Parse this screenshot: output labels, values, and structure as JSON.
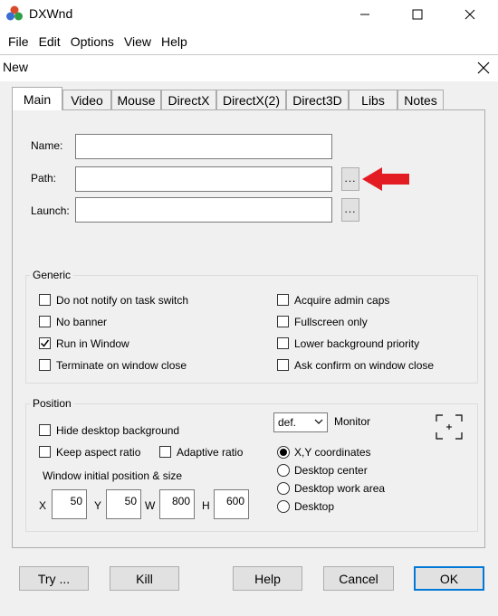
{
  "app": {
    "title": "DXWnd"
  },
  "menu": [
    "File",
    "Edit",
    "Options",
    "View",
    "Help"
  ],
  "dialog": {
    "title": "New"
  },
  "tabs": [
    "Main",
    "Video",
    "Mouse",
    "DirectX",
    "DirectX(2)",
    "Direct3D",
    "Libs",
    "Notes"
  ],
  "active_tab": "Main",
  "main": {
    "name_label": "Name:",
    "name_value": "",
    "path_label": "Path:",
    "path_value": "",
    "launch_label": "Launch:",
    "launch_value": "",
    "browse_label": "..."
  },
  "generic": {
    "title": "Generic",
    "options": [
      {
        "label": "Do not notify on task switch",
        "checked": false
      },
      {
        "label": "No banner",
        "checked": false
      },
      {
        "label": "Run in Window",
        "checked": true
      },
      {
        "label": "Terminate on window close",
        "checked": false
      },
      {
        "label": "Acquire admin caps",
        "checked": false
      },
      {
        "label": "Fullscreen only",
        "checked": false
      },
      {
        "label": "Lower background priority",
        "checked": false
      },
      {
        "label": "Ask confirm on window close",
        "checked": false
      }
    ]
  },
  "position": {
    "title": "Position",
    "hide_desktop": {
      "label": "Hide desktop background",
      "checked": false
    },
    "keep_aspect": {
      "label": "Keep aspect ratio",
      "checked": false
    },
    "adaptive": {
      "label": "Adaptive ratio",
      "checked": false
    },
    "initial_label": "Window initial position & size",
    "x_label": "X",
    "x_value": "50",
    "y_label": "Y",
    "y_value": "50",
    "w_label": "W",
    "w_value": "800",
    "h_label": "H",
    "h_value": "600",
    "monitor_value": "def.",
    "monitor_label": "Monitor",
    "radios": [
      {
        "label": "X,Y coordinates",
        "selected": true
      },
      {
        "label": "Desktop center",
        "selected": false
      },
      {
        "label": "Desktop work area",
        "selected": false
      },
      {
        "label": "Desktop",
        "selected": false
      }
    ]
  },
  "buttons": {
    "try": "Try ...",
    "kill": "Kill",
    "help": "Help",
    "cancel": "Cancel",
    "ok": "OK"
  },
  "colors": {
    "annotation_arrow": "#e31b23",
    "ok_border": "#0078d7"
  }
}
